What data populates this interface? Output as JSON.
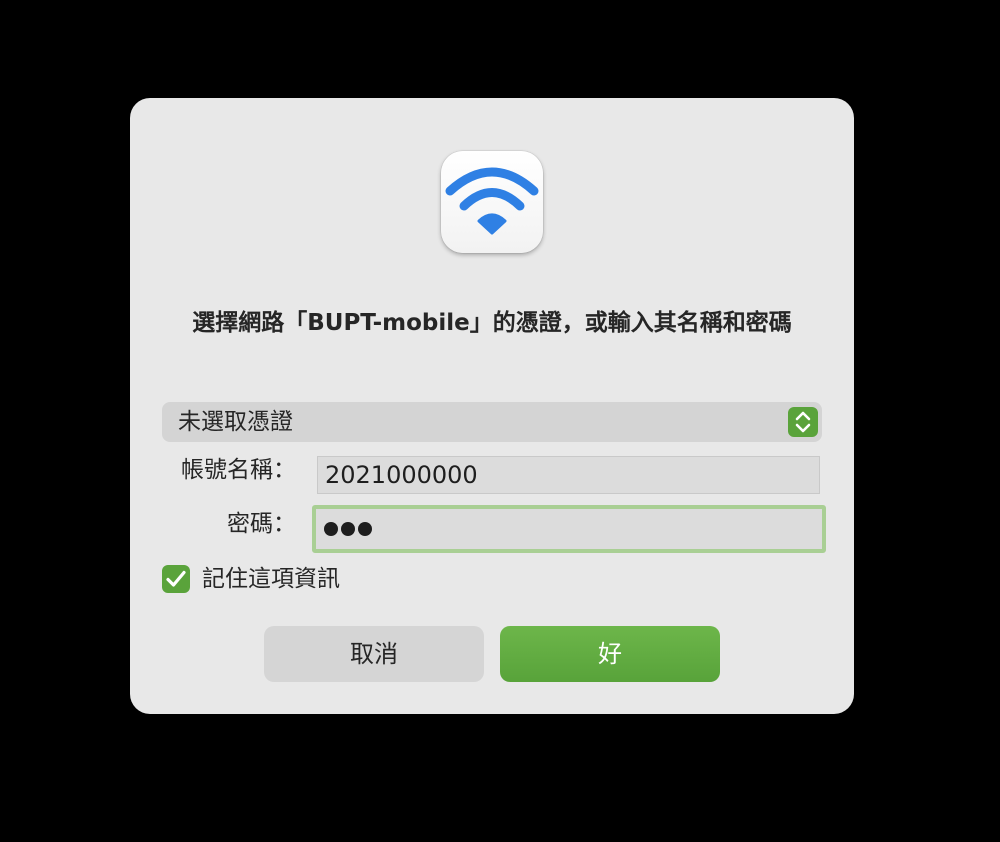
{
  "dialog": {
    "title": "選擇網路「BUPT-mobile」的憑證，或輸入其名稱和密碼",
    "icon": "wifi-icon",
    "accent_color": "#5aa33b",
    "wifi_color": "#2f80e4"
  },
  "certificate_select": {
    "value": "未選取憑證",
    "icon": "chevron-updown-icon"
  },
  "account": {
    "label": "帳號名稱：",
    "value": "2021000000"
  },
  "password": {
    "label": "密碼：",
    "masked_length": 3
  },
  "remember": {
    "label": "記住這項資訊",
    "checked": true
  },
  "buttons": {
    "cancel": "取消",
    "ok": "好"
  }
}
